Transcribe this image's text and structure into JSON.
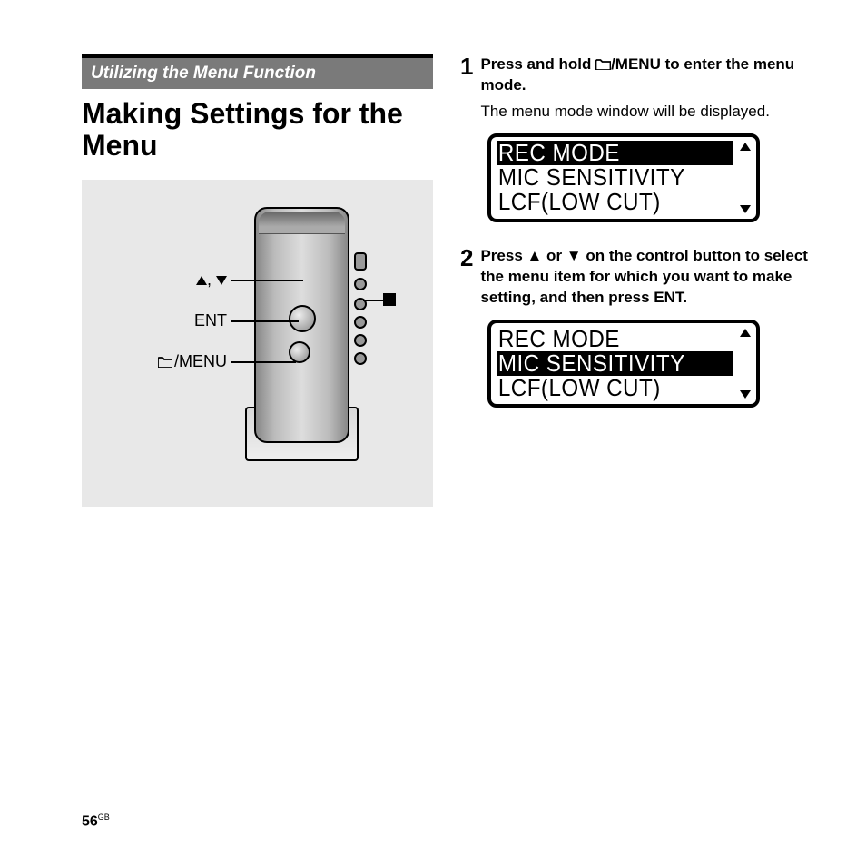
{
  "section_banner": "Utilizing the Menu Function",
  "heading": "Making Settings for the Menu",
  "illustration": {
    "label_up_down": ", ",
    "label_ent": "ENT",
    "label_menu": "/MENU",
    "label_stop_alt": "stop"
  },
  "steps": [
    {
      "num": "1",
      "bold_before": "Press and hold ",
      "bold_after": "/MENU to enter the menu mode.",
      "body": "The menu mode window will be displayed.",
      "lcd": {
        "rows": [
          "REC MODE",
          "MIC SENSITIVITY",
          "LCF(LOW CUT)"
        ],
        "selected_index": 0
      }
    },
    {
      "num": "2",
      "bold_full": "Press ▲ or ▼ on the control button to select the menu item for which you want to make setting, and then press ENT.",
      "lcd": {
        "rows": [
          "REC MODE",
          "MIC SENSITIVITY",
          "LCF(LOW CUT)"
        ],
        "selected_index": 1
      }
    }
  ],
  "page_number": "56",
  "page_number_suffix": "GB"
}
